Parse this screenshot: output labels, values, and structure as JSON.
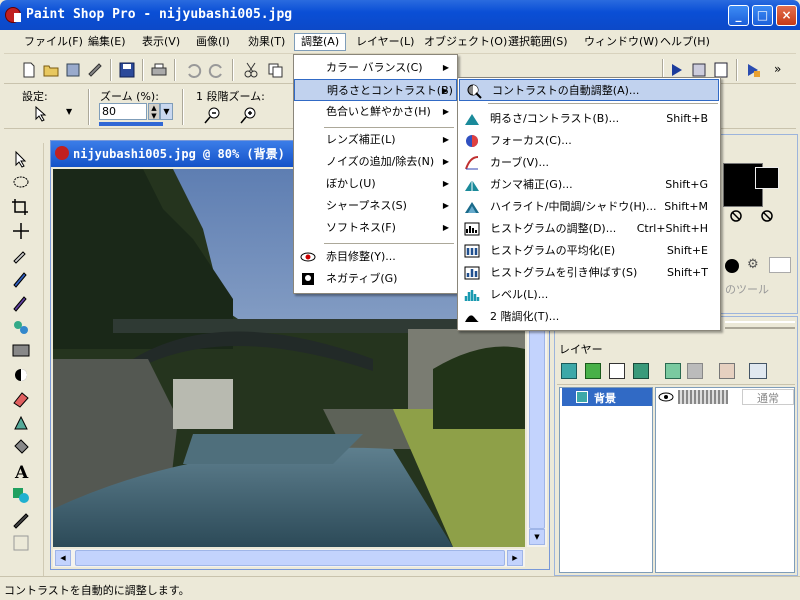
{
  "window": {
    "title": "Paint Shop Pro - nijyubashi005.jpg",
    "min": "_",
    "max": "□",
    "close": "×"
  },
  "menubar": [
    "ファイル(F)",
    "編集(E)",
    "表示(V)",
    "画像(I)",
    "効果(T)",
    "調整(A)",
    "レイヤー(L)",
    "オブジェクト(O)",
    "選択範囲(S)",
    "ウィンドウ(W)",
    "ヘルプ(H)"
  ],
  "options_bar": {
    "preset_label": "設定:",
    "zoom_label": "ズーム (%):",
    "zoom_value": "80",
    "step_zoom_label": "1 段階ズーム:"
  },
  "document": {
    "title": "nijyubashi005.jpg @  80% (背景)"
  },
  "adjust_menu": [
    {
      "label": "カラー バランス(C)",
      "submenu": true
    },
    {
      "label": "明るさとコントラスト(B)",
      "submenu": true,
      "active": true
    },
    {
      "label": "色合いと鮮やかさ(H)",
      "submenu": true
    },
    {
      "label": "レンズ補正(L)",
      "submenu": true
    },
    {
      "label": "ノイズの追加/除去(N)",
      "submenu": true
    },
    {
      "label": "ぼかし(U)",
      "submenu": true
    },
    {
      "label": "シャープネス(S)",
      "submenu": true
    },
    {
      "label": "ソフトネス(F)",
      "submenu": true
    },
    {
      "label": "赤目修整(Y)...",
      "submenu": false,
      "icon": "red-eye-icon"
    },
    {
      "label": "ネガティブ(G)",
      "submenu": false,
      "icon": "negative-icon"
    }
  ],
  "brightness_submenu": [
    {
      "label": "コントラストの自動調整(A)...",
      "shortcut": "",
      "highlighted": true,
      "icon": "auto-contrast-icon"
    },
    {
      "label": "明るさ/コントラスト(B)...",
      "shortcut": "Shift+B",
      "icon": "brightness-contrast-icon"
    },
    {
      "label": "フォーカス(C)...",
      "shortcut": "",
      "icon": "focus-icon"
    },
    {
      "label": "カーブ(V)...",
      "shortcut": "",
      "icon": "curves-icon"
    },
    {
      "label": "ガンマ補正(G)...",
      "shortcut": "Shift+G",
      "icon": "gamma-icon"
    },
    {
      "label": "ハイライト/中間調/シャドウ(H)...",
      "shortcut": "Shift+M",
      "icon": "highlight-midtone-shadow-icon"
    },
    {
      "label": "ヒストグラムの調整(D)...",
      "shortcut": "Ctrl+Shift+H",
      "icon": "histogram-adjust-icon"
    },
    {
      "label": "ヒストグラムの平均化(E)",
      "shortcut": "Shift+E",
      "icon": "histogram-equalize-icon"
    },
    {
      "label": "ヒストグラムを引き伸ばす(S)",
      "shortcut": "Shift+T",
      "icon": "histogram-stretch-icon"
    },
    {
      "label": "レベル(L)...",
      "shortcut": "",
      "icon": "levels-icon"
    },
    {
      "label": "2 階調化(T)...",
      "shortcut": "",
      "icon": "threshold-icon"
    }
  ],
  "materials_panel": {
    "partial_label": "のツール"
  },
  "layers_panel": {
    "title": "レイヤー",
    "layer_name": "背景",
    "blend_mode": "通常"
  },
  "status": {
    "text": "コントラストを自動的に調整します。"
  },
  "colors": {
    "titlebar": "#0A4FD6",
    "menu_highlight": "#C1D2EE",
    "menu_highlight_border": "#316AC5"
  }
}
